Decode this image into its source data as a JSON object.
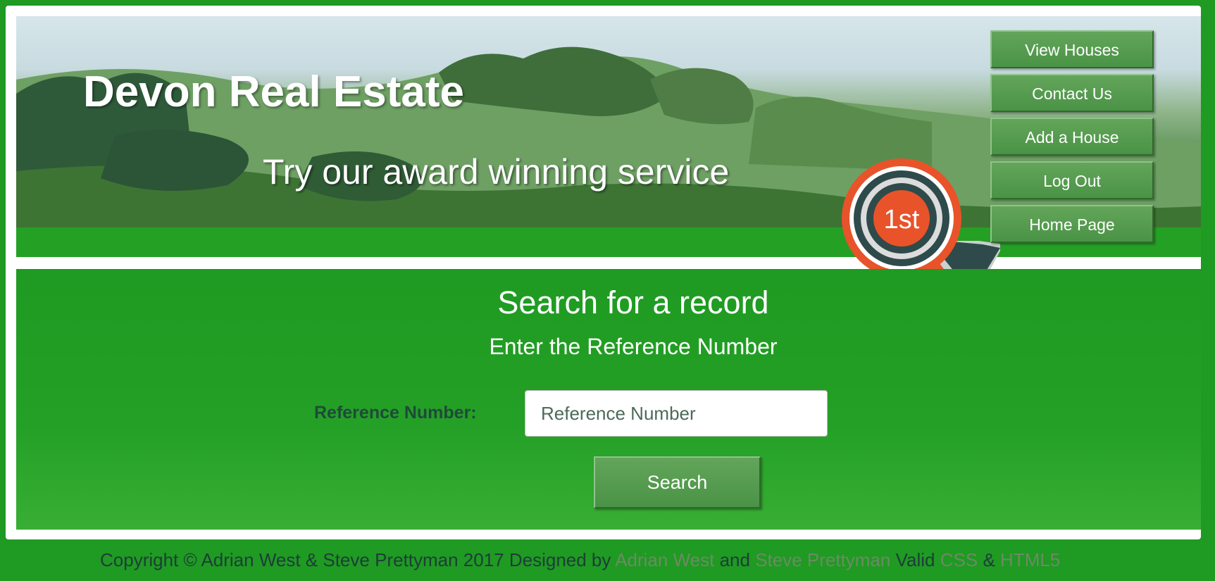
{
  "header": {
    "site_title": "Devon Real Estate",
    "tagline": "Try our award winning service",
    "badge_text": "1st"
  },
  "nav": {
    "items": [
      {
        "label": "View Houses"
      },
      {
        "label": "Contact Us"
      },
      {
        "label": "Add a House"
      },
      {
        "label": "Log Out"
      },
      {
        "label": "Home Page"
      }
    ]
  },
  "search": {
    "title": "Search for a record",
    "subtitle": "Enter the Reference Number",
    "label": "Reference Number:",
    "placeholder": "Reference Number",
    "value": "",
    "button_label": "Search"
  },
  "footer": {
    "copyright": "Copyright © Adrian West & Steve Prettyman 2017 Designed by",
    "designer1": "Adrian West",
    "and": "and",
    "designer2": "Steve Prettyman",
    "valid": "Valid",
    "css_link": "CSS",
    "amp": "&",
    "html_link": "HTML5"
  },
  "colors": {
    "page_green": "#1f9a22",
    "button_green": "#4a9346",
    "ribbon_orange": "#e8532a",
    "ribbon_dark": "#2f4a4a",
    "footer_text": "#1e3d3a",
    "footer_link": "#6d8a66"
  }
}
